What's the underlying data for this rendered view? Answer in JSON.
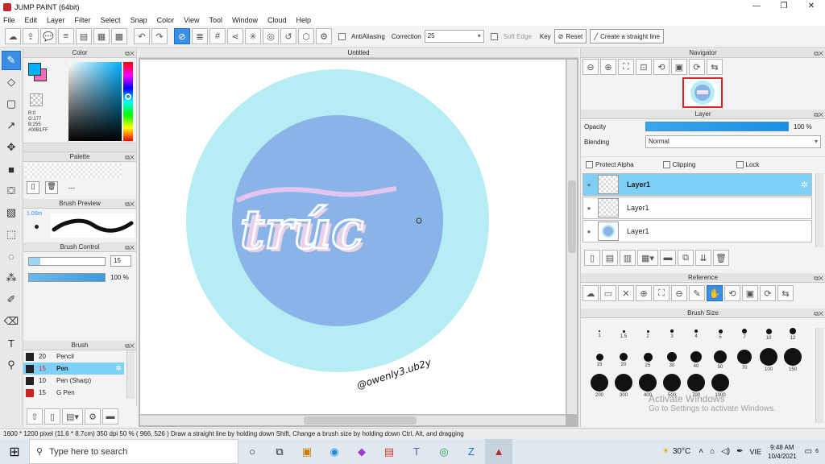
{
  "window": {
    "title": "JUMP PAINT (64bit)"
  },
  "menu": [
    "File",
    "Edit",
    "Layer",
    "Filter",
    "Select",
    "Snap",
    "Color",
    "View",
    "Tool",
    "Window",
    "Cloud",
    "Help"
  ],
  "toolbar": {
    "antialiasing_label": "AntiAliasing",
    "correction_label": "Correction",
    "correction_value": "25",
    "soft_edge_label": "Soft Edge",
    "key_label": "Key",
    "reset_label": "Reset",
    "straight_line_label": "Create a straight line"
  },
  "color_panel": {
    "title": "Color",
    "r": "R:0",
    "g": "G:177",
    "b": "B:255",
    "hex": "#00B1FF"
  },
  "palette_panel": {
    "title": "Palette",
    "name": "---"
  },
  "brush_preview": {
    "title": "Brush Preview",
    "size": "1.09m"
  },
  "brush_control": {
    "title": "Brush Control",
    "size_value": "15",
    "opacity_value": "100 %"
  },
  "brush_list": {
    "title": "Brush",
    "items": [
      {
        "size": "20",
        "name": "Pencil",
        "color": "#222222"
      },
      {
        "size": "15",
        "name": "Pen",
        "color": "#222222"
      },
      {
        "size": "10",
        "name": "Pen (Sharp)",
        "color": "#222222"
      },
      {
        "size": "15",
        "name": "G Pen",
        "color": "#d02020"
      }
    ]
  },
  "canvas": {
    "tab_title": "Untitled",
    "signature": "@owenly3.ub2y"
  },
  "navigator": {
    "title": "Navigator"
  },
  "layer_panel": {
    "title": "Layer",
    "opacity_label": "Opacity",
    "opacity_value": "100 %",
    "blending_label": "Blending",
    "blending_value": "Normal",
    "protect_alpha": "Protect Alpha",
    "clipping": "Clipping",
    "lock": "Lock",
    "layers": [
      "Layer1",
      "Layer1",
      "Layer1"
    ]
  },
  "reference": {
    "title": "Reference"
  },
  "brush_size": {
    "title": "Brush Size",
    "sizes": [
      "1",
      "1.5",
      "2",
      "3",
      "4",
      "5",
      "7",
      "10",
      "12",
      "15",
      "20",
      "25",
      "30",
      "40",
      "50",
      "70",
      "100",
      "150",
      "200",
      "300",
      "400",
      "500",
      "700",
      "1000"
    ]
  },
  "status": {
    "text": "1600 * 1200 pixel   (11.6 * 8.7cm)   350 dpi   50 %   ( 966, 526 )   Draw a straight line by holding down Shift, Change a brush size by holding down Ctrl, Alt, and dragging"
  },
  "taskbar": {
    "search_placeholder": "Type here to search",
    "weather": "30°C",
    "lang": "VIE",
    "time": "9:48 AM",
    "date": "10/4/2021",
    "notifications": "6"
  },
  "watermark": {
    "line1": "Activate Windows",
    "line2": "Go to Settings to activate Windows."
  },
  "colors": {
    "accent": "#3a8ee6",
    "outer_circle": "#b6ecf4",
    "inner_circle": "#8ab4e8",
    "layer_selected": "#7fd0f6"
  }
}
